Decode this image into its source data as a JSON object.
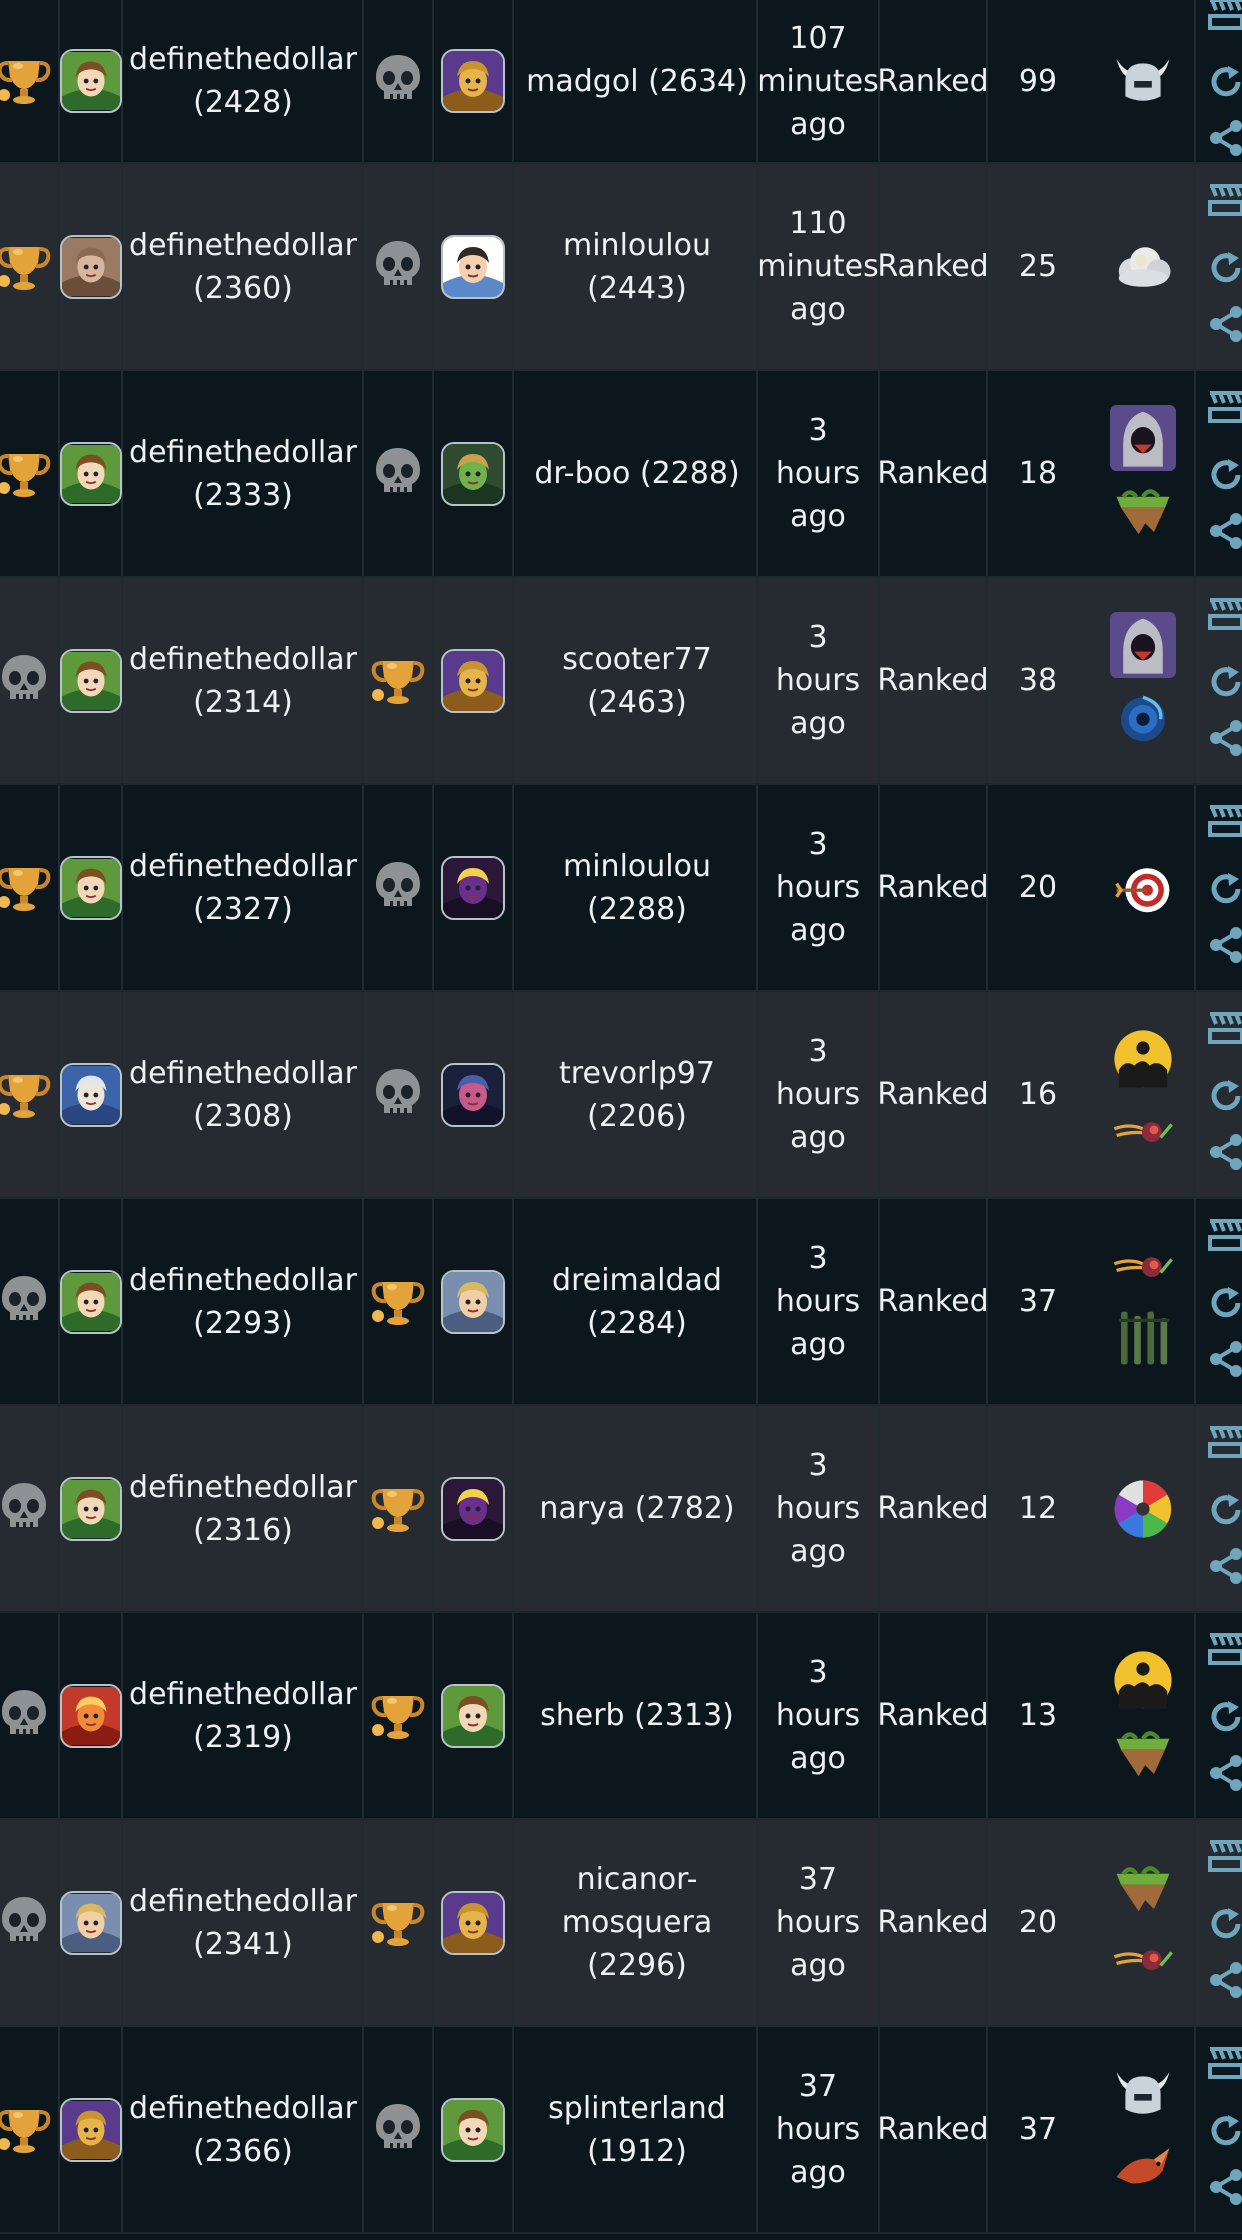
{
  "battles": [
    {
      "result": "win",
      "player_avatar": "forest-elf",
      "player": "definethedollar (2428)",
      "opp_result": "loss",
      "opp_avatar": "golden-knight",
      "opponent": "madgol (2634)",
      "time": "107 minutes ago",
      "mode": "Ranked",
      "mana": "99",
      "splinters": [
        "horned-helm"
      ]
    },
    {
      "result": "win",
      "player_avatar": "bearded-man",
      "player": "definethedollar (2360)",
      "opp_result": "loss",
      "opp_avatar": "couple",
      "opponent": "minloulou (2443)",
      "time": "110 minutes ago",
      "mode": "Ranked",
      "mana": "25",
      "splinters": [
        "cloud"
      ]
    },
    {
      "result": "win",
      "player_avatar": "forest-elf",
      "player": "definethedollar (2333)",
      "opp_result": "loss",
      "opp_avatar": "green-warrior",
      "opponent": "dr-boo (2288)",
      "time": "3 hours ago",
      "mode": "Ranked",
      "mana": "18",
      "splinters": [
        "hooded-figure",
        "floating-island"
      ]
    },
    {
      "result": "loss",
      "player_avatar": "forest-elf",
      "player": "definethedollar (2314)",
      "opp_result": "win",
      "opp_avatar": "golden-knight",
      "opponent": "scooter77 (2463)",
      "time": "3 hours ago",
      "mode": "Ranked",
      "mana": "38",
      "splinters": [
        "hooded-figure",
        "blue-vortex"
      ]
    },
    {
      "result": "win",
      "player_avatar": "forest-elf",
      "player": "definethedollar (2327)",
      "opp_result": "loss",
      "opp_avatar": "purple-demon",
      "opponent": "minloulou (2288)",
      "time": "3 hours ago",
      "mode": "Ranked",
      "mana": "20",
      "splinters": [
        "target"
      ]
    },
    {
      "result": "win",
      "player_avatar": "wizard",
      "player": "definethedollar (2308)",
      "opp_result": "loss",
      "opp_avatar": "dark-mage",
      "opponent": "trevorlp97 (2206)",
      "time": "3 hours ago",
      "mode": "Ranked",
      "mana": "16",
      "splinters": [
        "yellow-moon",
        "comet"
      ]
    },
    {
      "result": "loss",
      "player_avatar": "forest-elf",
      "player": "definethedollar (2293)",
      "opp_result": "win",
      "opp_avatar": "blonde-hero",
      "opponent": "dreimaldad (2284)",
      "time": "3 hours ago",
      "mode": "Ranked",
      "mana": "37",
      "splinters": [
        "comet",
        "iron-bars"
      ]
    },
    {
      "result": "loss",
      "player_avatar": "forest-elf",
      "player": "definethedollar (2316)",
      "opp_result": "win",
      "opp_avatar": "purple-demon",
      "opponent": "narya (2782)",
      "time": "3 hours ago",
      "mode": "Ranked",
      "mana": "12",
      "splinters": [
        "color-wheel"
      ]
    },
    {
      "result": "loss",
      "player_avatar": "fire-dragon",
      "player": "definethedollar (2319)",
      "opp_result": "win",
      "opp_avatar": "forest-elf",
      "opponent": "sherb (2313)",
      "time": "3 hours ago",
      "mode": "Ranked",
      "mana": "13",
      "splinters": [
        "yellow-moon",
        "floating-island"
      ]
    },
    {
      "result": "loss",
      "player_avatar": "blonde-hero",
      "player": "definethedollar (2341)",
      "opp_result": "win",
      "opp_avatar": "golden-knight",
      "opponent": "nicanor-mosquera (2296)",
      "time": "37 hours ago",
      "mode": "Ranked",
      "mana": "20",
      "splinters": [
        "floating-island",
        "comet"
      ]
    },
    {
      "result": "win",
      "player_avatar": "golden-knight",
      "player": "definethedollar (2366)",
      "opp_result": "loss",
      "opp_avatar": "forest-elf",
      "opponent": "splinterland (1912)",
      "time": "37 hours ago",
      "mode": "Ranked",
      "mana": "37",
      "splinters": [
        "horned-helm",
        "red-fox"
      ]
    }
  ],
  "row_actions": [
    "battle-details-icon",
    "replay-icon",
    "share-icon"
  ],
  "colors": {
    "row_dark": "#0b161d",
    "row_light": "#252b30",
    "text": "#eef1f4",
    "trophy_gold": "#e3a23a",
    "skull_gray": "#8e9295",
    "action_blue": "#6fa6be"
  }
}
